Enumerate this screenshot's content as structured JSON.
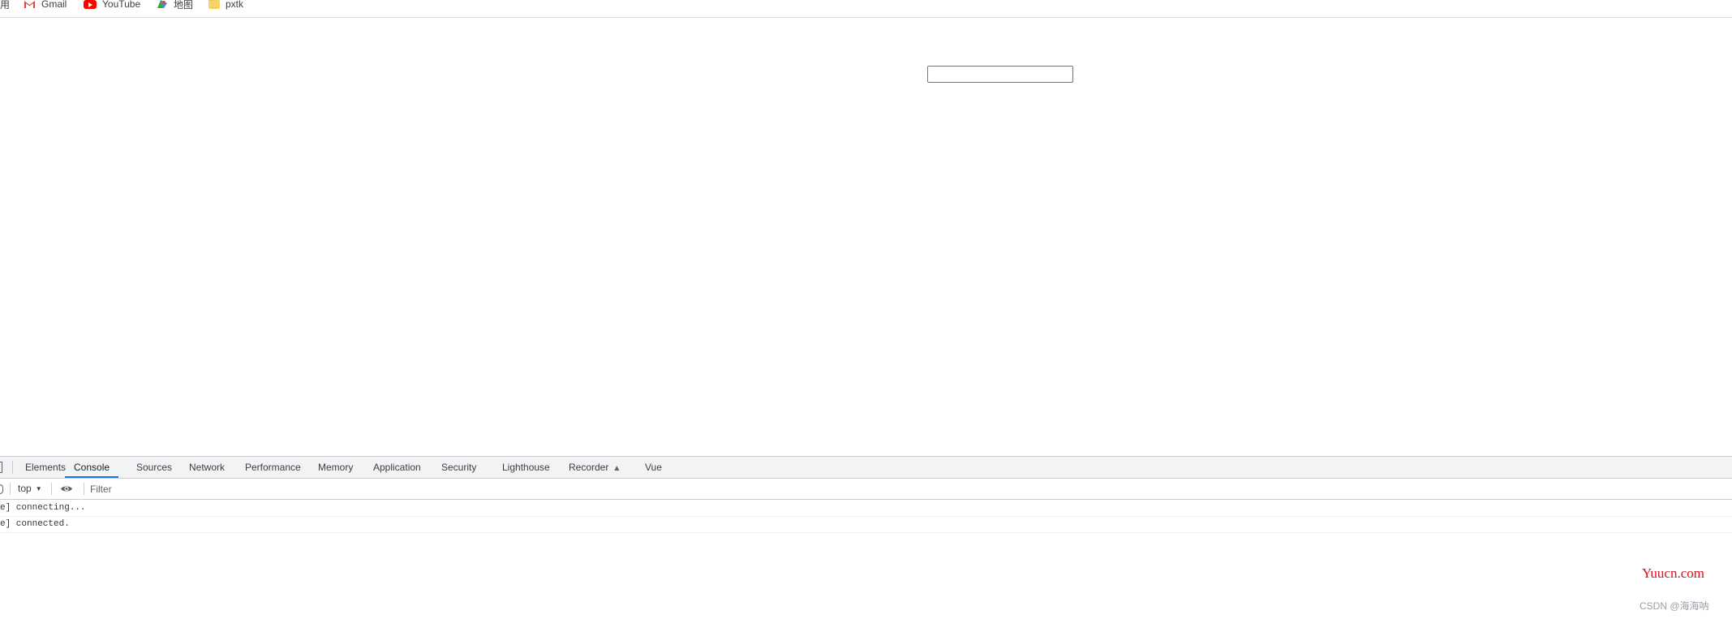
{
  "bookmarks_bar": {
    "items": [
      {
        "label": "用",
        "icon": ""
      },
      {
        "label": "Gmail",
        "icon": "gmail-icon"
      },
      {
        "label": "YouTube",
        "icon": "youtube-icon"
      },
      {
        "label": "地图",
        "icon": "maps-icon"
      },
      {
        "label": "pxtk",
        "icon": "folder-icon"
      }
    ]
  },
  "page": {
    "text_input_value": ""
  },
  "devtools": {
    "tabs": [
      {
        "label": "Elements"
      },
      {
        "label": "Console",
        "active": true
      },
      {
        "label": "Sources"
      },
      {
        "label": "Network"
      },
      {
        "label": "Performance"
      },
      {
        "label": "Memory"
      },
      {
        "label": "Application"
      },
      {
        "label": "Security"
      },
      {
        "label": "Lighthouse"
      },
      {
        "label": "Recorder"
      },
      {
        "label": "Vue"
      }
    ],
    "toolbar": {
      "context": "top",
      "filter_placeholder": "Filter"
    },
    "console_messages": [
      "e] connecting...",
      "e] connected."
    ]
  },
  "watermarks": {
    "site": "Yuucn.com",
    "author": "CSDN @海海呐"
  },
  "colors": {
    "active_tab_underline": "#1a73e8",
    "watermark_red": "#d8131e"
  }
}
